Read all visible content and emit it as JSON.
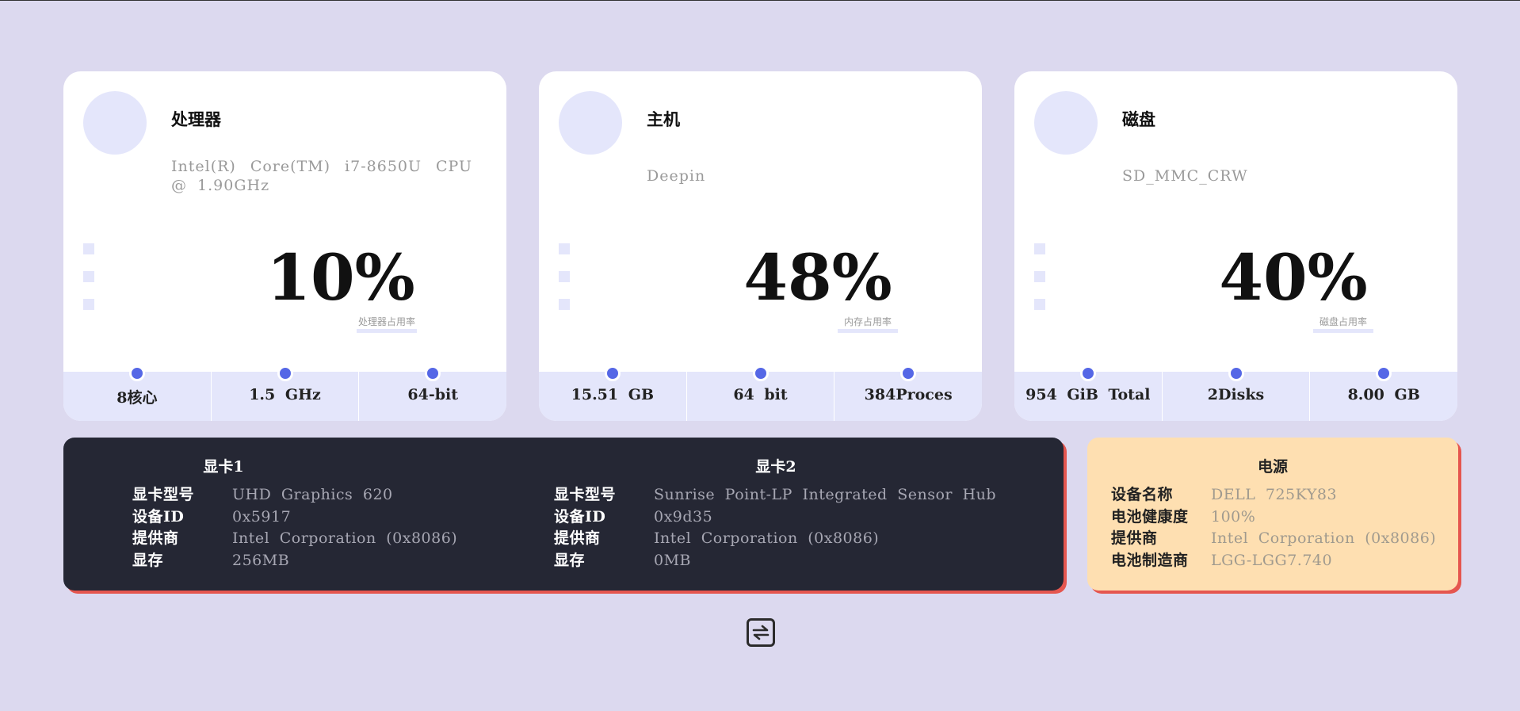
{
  "cards": [
    {
      "title": "处理器",
      "desc": "Intel(R) Core(TM) i7-8650U CPU @ 1.90GHz",
      "percent": "10%",
      "caption": "处理器占用率",
      "stats": [
        "8核心",
        "1.5 GHz",
        "64-bit"
      ]
    },
    {
      "title": "主机",
      "desc": "Deepin",
      "percent": "48%",
      "caption": "内存占用率",
      "stats": [
        "15.51 GB",
        "64 bit",
        "384Proces"
      ]
    },
    {
      "title": "磁盘",
      "desc": "SD_MMC_CRW",
      "percent": "40%",
      "caption": "磁盘占用率",
      "stats": [
        "954 GiB Total",
        "2Disks",
        "8.00 GB"
      ]
    }
  ],
  "gpus": [
    {
      "title": "显卡1",
      "rows": [
        {
          "k": "显卡型号",
          "v": "UHD Graphics 620"
        },
        {
          "k": "设备ID",
          "v": "0x5917"
        },
        {
          "k": "提供商",
          "v": "Intel Corporation (0x8086)"
        },
        {
          "k": "显存",
          "v": "256MB"
        }
      ]
    },
    {
      "title": "显卡2",
      "rows": [
        {
          "k": "显卡型号",
          "v": "Sunrise Point-LP Integrated Sensor Hub"
        },
        {
          "k": "设备ID",
          "v": "0x9d35"
        },
        {
          "k": "提供商",
          "v": "Intel Corporation (0x8086)"
        },
        {
          "k": "显存",
          "v": "0MB"
        }
      ]
    }
  ],
  "power": {
    "title": "电源",
    "rows": [
      {
        "k": "设备名称",
        "v": "DELL 725KY83"
      },
      {
        "k": "电池健康度",
        "v": "100%"
      },
      {
        "k": "提供商",
        "v": "Intel Corporation (0x8086)"
      },
      {
        "k": "电池制造商",
        "v": "LGG-LGG7.740"
      }
    ]
  },
  "colors": {
    "background": "#dcd9ef",
    "accent_dot": "#5567e6",
    "gpu_panel": "#252734",
    "power_panel": "#fedfb1",
    "shadow": "#e5564f"
  },
  "icons": {
    "swap": "swap-arrows-icon"
  }
}
